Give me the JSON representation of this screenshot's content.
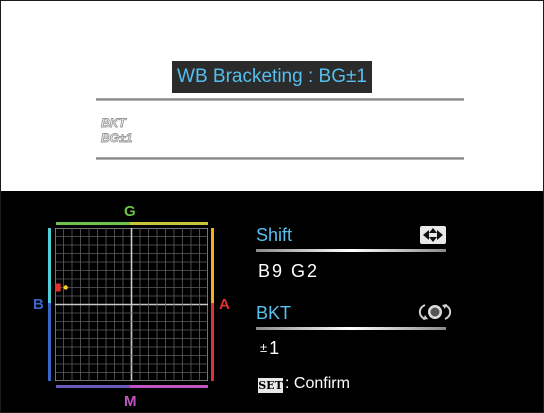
{
  "menu": {
    "title": "WB Bracketing : BG±1",
    "bkt_icon_text": [
      "BKT",
      "BG±1"
    ]
  },
  "grid_labels": {
    "top": "G",
    "bottom": "M",
    "left": "B",
    "right": "A"
  },
  "shift": {
    "label": "Shift",
    "value": "B9 G2",
    "icon": "four-way-arrows-icon"
  },
  "bkt": {
    "label": "BKT",
    "value_prefix": "±",
    "value": "1",
    "icon": "main-dial-icon"
  },
  "footer": {
    "set_badge": "SET",
    "confirm": ": Confirm"
  },
  "colors": {
    "accent": "#56c2f0",
    "green": "#6cc24a",
    "blue": "#3a66c8",
    "amber": "#f2b01e",
    "red": "#e03030",
    "magenta": "#c054c0",
    "cyan": "#4fd0d8"
  }
}
